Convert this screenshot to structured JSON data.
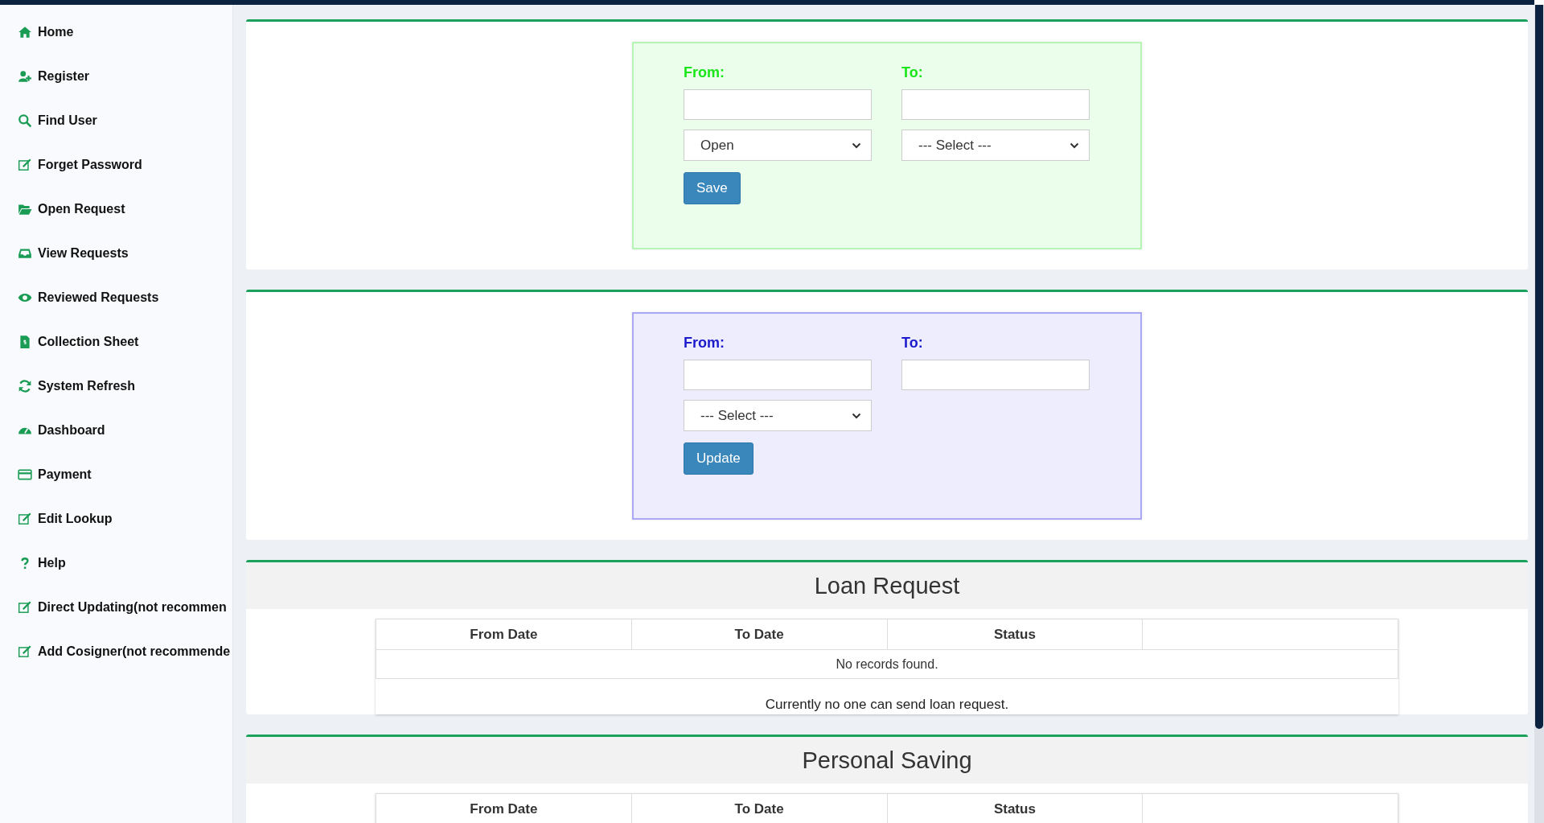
{
  "sidebar": {
    "items": [
      {
        "label": "Home"
      },
      {
        "label": "Register"
      },
      {
        "label": "Find User"
      },
      {
        "label": "Forget Password"
      },
      {
        "label": "Open Request"
      },
      {
        "label": "View Requests"
      },
      {
        "label": "Reviewed Requests"
      },
      {
        "label": "Collection Sheet"
      },
      {
        "label": "System Refresh"
      },
      {
        "label": "Dashboard"
      },
      {
        "label": "Payment"
      },
      {
        "label": "Edit Lookup"
      },
      {
        "label": "Help"
      },
      {
        "label": "Direct Updating(not recommen"
      },
      {
        "label": "Add Cosigner(not recommende"
      }
    ]
  },
  "forms": [
    {
      "from_label": "From:",
      "to_label": "To:",
      "selects": [
        "Open",
        "--- Select ---"
      ],
      "button": "Save"
    },
    {
      "from_label": "From:",
      "to_label": "To:",
      "selects": [
        "--- Select ---"
      ],
      "button": "Update"
    }
  ],
  "tables": [
    {
      "title": "Loan Request",
      "columns": [
        "From Date",
        "To Date",
        "Status",
        ""
      ],
      "empty_text": "No records found.",
      "note": "Currently no one can send loan request."
    },
    {
      "title": "Personal Saving",
      "columns": [
        "From Date",
        "To Date",
        "Status",
        ""
      ]
    }
  ]
}
